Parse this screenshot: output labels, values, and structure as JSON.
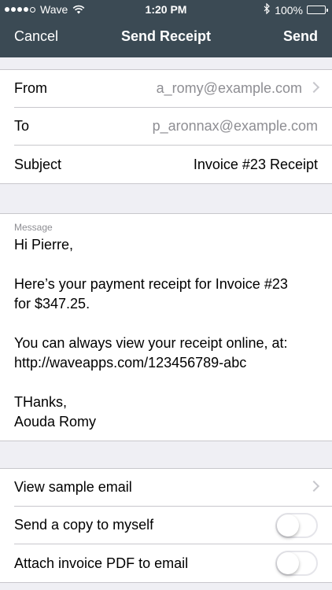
{
  "status_bar": {
    "carrier": "Wave",
    "time": "1:20 PM",
    "battery": "100%"
  },
  "nav": {
    "cancel_label": "Cancel",
    "title": "Send Receipt",
    "send_label": "Send"
  },
  "fields": {
    "from_label": "From",
    "from_value": "a_romy@example.com",
    "to_label": "To",
    "to_value": "p_aronnax@example.com",
    "subject_label": "Subject",
    "subject_value": "Invoice #23 Receipt"
  },
  "message": {
    "label": "Message",
    "body": "Hi Pierre,\n\nHere’s your payment receipt for Invoice #23\nfor $347.25.\n\nYou can always view your receipt online, at:\nhttp://waveapps.com/123456789-abc\n\nTHanks,\nAouda Romy"
  },
  "options": {
    "view_sample_label": "View sample email",
    "send_copy_label": "Send a copy to myself",
    "send_copy_on": false,
    "attach_pdf_label": "Attach invoice PDF to email",
    "attach_pdf_on": false
  },
  "colors": {
    "header_bg": "#3b4a54",
    "page_bg": "#efeff4",
    "secondary_text": "#8e8e93"
  }
}
